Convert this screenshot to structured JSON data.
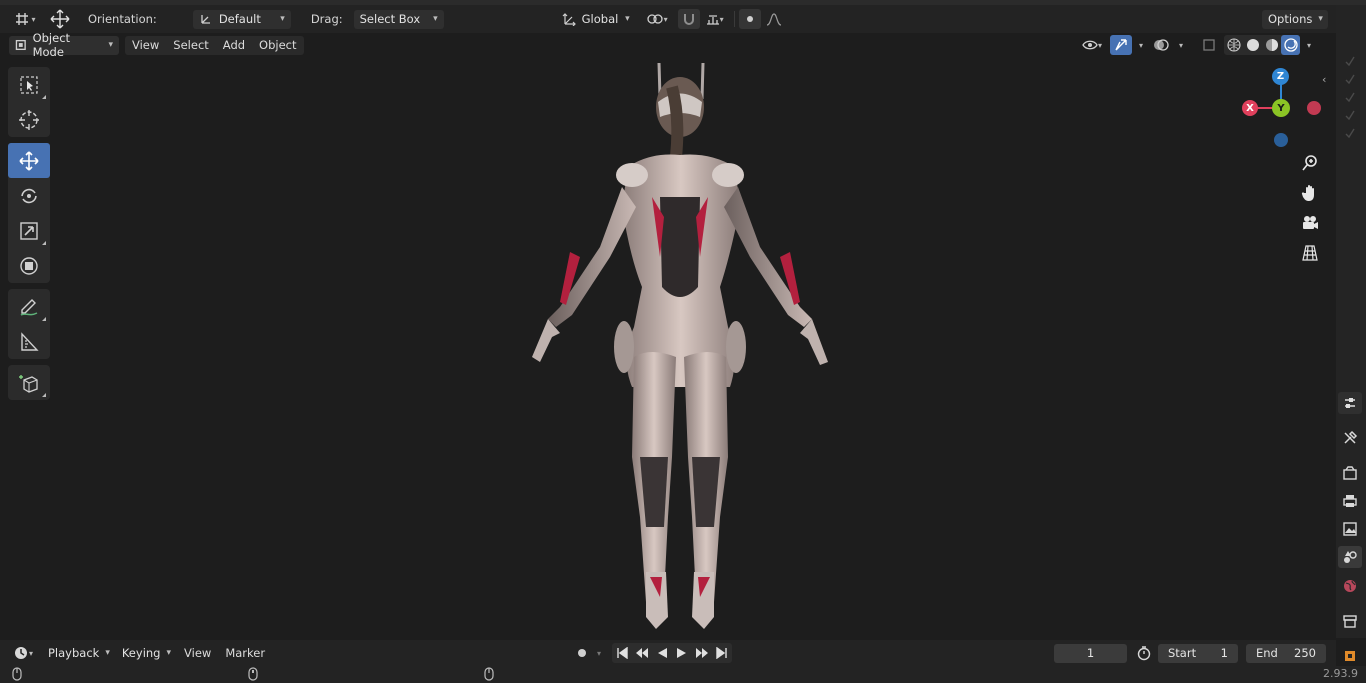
{
  "toolheader": {
    "orientation_label": "Orientation:",
    "orientation_value": "Default",
    "drag_label": "Drag:",
    "drag_value": "Select Box",
    "transform_space": "Global",
    "options_label": "Options"
  },
  "viewport_header": {
    "mode": "Object Mode",
    "menus": [
      "View",
      "Select",
      "Add",
      "Object"
    ]
  },
  "gizmo": {
    "x_label": "X",
    "y_label": "Y",
    "z_label": "Z",
    "x_color": "#e0405c",
    "y_color": "#8bc425",
    "z_color": "#2f86d4",
    "neg_x_color": "#c23a52",
    "neg_z_color": "#2a5f99"
  },
  "tools": [
    "select-box",
    "cursor",
    "move",
    "rotate",
    "scale",
    "transform",
    "annotate",
    "measure",
    "add-cube"
  ],
  "timeline": {
    "menus": [
      "Playback",
      "Keying",
      "View",
      "Marker"
    ],
    "current_frame": "1",
    "start_label": "Start",
    "start_value": "1",
    "end_label": "End",
    "end_value": "250"
  },
  "status": {
    "version": "2.93.9"
  },
  "colors": {
    "accent": "#4772b3",
    "background": "#1d1d1d",
    "header": "#232323"
  }
}
